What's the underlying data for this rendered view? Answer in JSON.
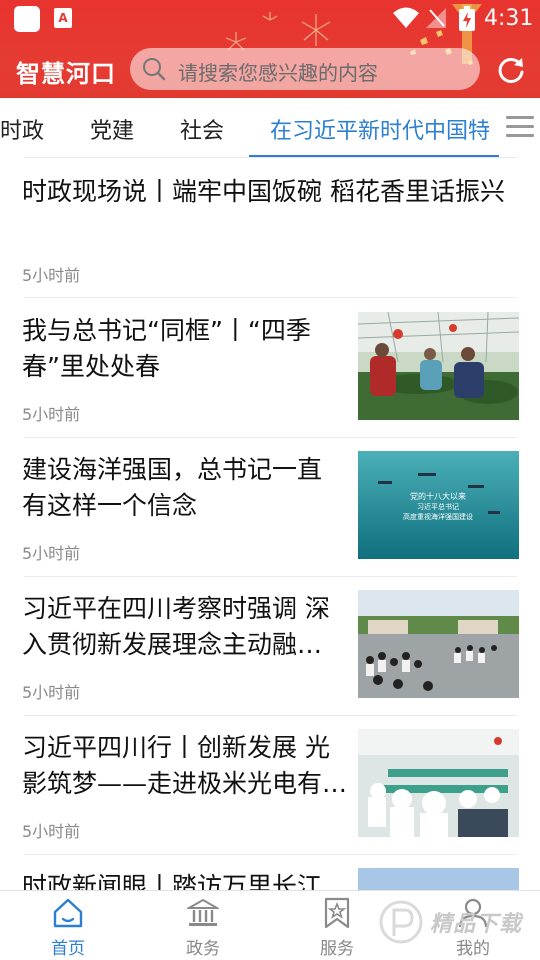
{
  "status_bar": {
    "time": "4:31",
    "app_icon_letter": "A"
  },
  "header": {
    "app_title": "智慧河口",
    "search_placeholder": "请搜索您感兴趣的内容",
    "brand_color": "#e53b33"
  },
  "tabs": [
    {
      "label": "时政"
    },
    {
      "label": "党建"
    },
    {
      "label": "社会"
    },
    {
      "label": "在习近平新时代中国特"
    }
  ],
  "accent_color": "#2d7fd2",
  "news": [
    {
      "title": "时政现场说丨端牢中国饭碗 稻花香里话振兴",
      "time": "5小时前",
      "thumb": ""
    },
    {
      "title": "我与总书记“同框”丨“四季春”里处处春",
      "time": "5小时前",
      "thumb": "greenhouse-photo"
    },
    {
      "title": "建设海洋强国，总书记一直有这样一个信念",
      "time": "5小时前",
      "thumb": "ocean-photo",
      "thumb_lines": [
        "党的十八大以来",
        "习近平总书记",
        "高度重视海洋强国建设"
      ]
    },
    {
      "title": "习近平在四川考察时强调 深入贯彻新发展理念主动融…",
      "time": "5小时前",
      "thumb": "crowd-photo"
    },
    {
      "title": "习近平四川行丨创新发展 光影筑梦——走进极米光电有…",
      "time": "5小时前",
      "thumb": "factory-photo"
    },
    {
      "title": "时政新闻眼丨踏访万里长江",
      "time": "",
      "thumb": "river-photo"
    }
  ],
  "bottom_nav": [
    {
      "label": "首页",
      "icon": "home-icon",
      "active": true
    },
    {
      "label": "政务",
      "icon": "government-building-icon",
      "active": false
    },
    {
      "label": "服务",
      "icon": "bookmark-star-icon",
      "active": false
    },
    {
      "label": "我的",
      "icon": "user-icon",
      "active": false
    }
  ],
  "watermark": "精品下载"
}
